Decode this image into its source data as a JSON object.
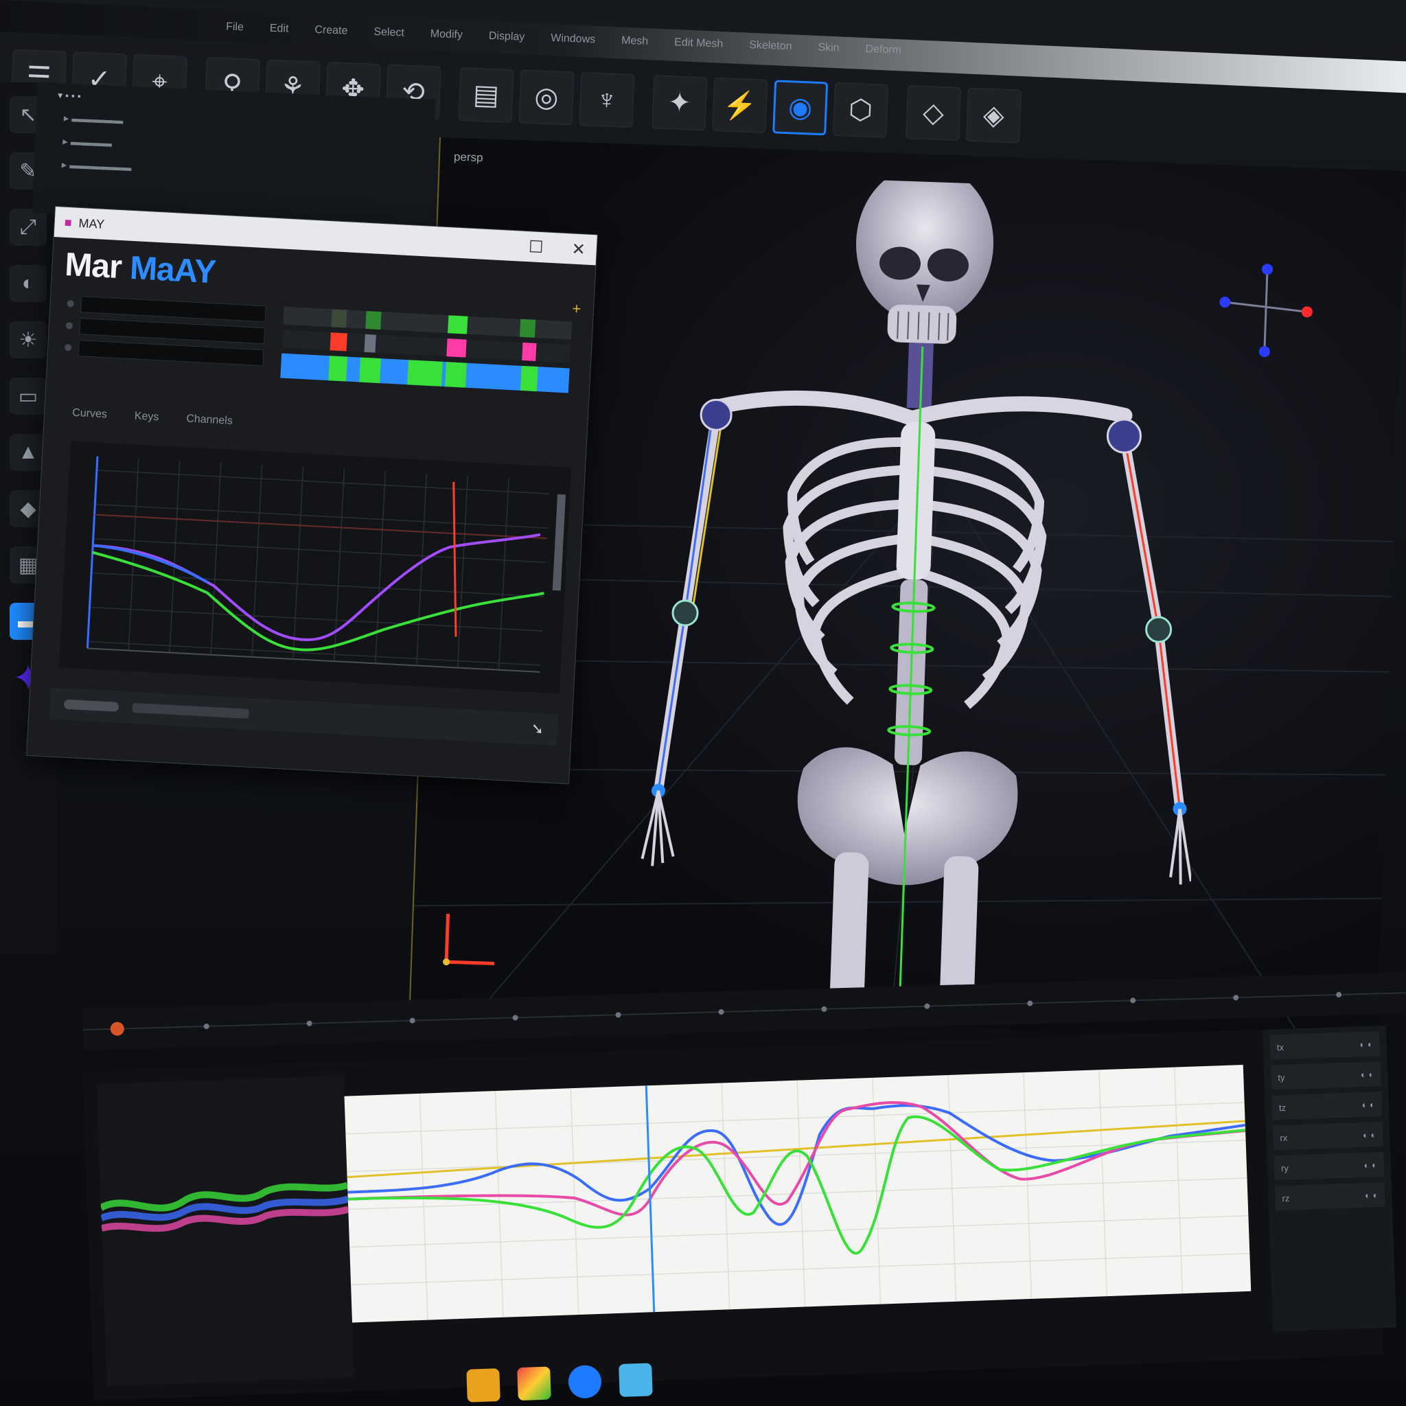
{
  "menubar": {
    "items": [
      "File",
      "Edit",
      "Create",
      "Select",
      "Modify",
      "Display",
      "Windows",
      "Mesh",
      "Edit Mesh",
      "Skeleton",
      "Skin",
      "Deform"
    ]
  },
  "shelf": {
    "tools": [
      {
        "name": "layout-icon",
        "glyph": "☰"
      },
      {
        "name": "check-icon",
        "glyph": "✓"
      },
      {
        "name": "lasso-icon",
        "glyph": "⌖"
      },
      {
        "name": "joint-tool-icon",
        "glyph": "⚲"
      },
      {
        "name": "ik-handle-icon",
        "glyph": "⚘"
      },
      {
        "name": "move-icon",
        "glyph": "✥"
      },
      {
        "name": "rotate-icon",
        "glyph": "⟲"
      },
      {
        "name": "graph-editor-icon",
        "glyph": "▤"
      },
      {
        "name": "orbit-icon",
        "glyph": "◎"
      },
      {
        "name": "pose-icon",
        "glyph": "♆"
      },
      {
        "name": "bone-icon",
        "glyph": "✦"
      },
      {
        "name": "render-icon",
        "glyph": "⚡"
      },
      {
        "name": "camera-icon",
        "glyph": "◉"
      },
      {
        "name": "snap-icon",
        "glyph": "⬡"
      },
      {
        "name": "key-tangent-icon",
        "glyph": "◇"
      },
      {
        "name": "key-diamond-icon",
        "glyph": "◈"
      }
    ],
    "active_index": 12
  },
  "viewport": {
    "tab_label": "persp",
    "camera_label": "persp"
  },
  "float_window": {
    "title": "MAY",
    "brand_word1": "Mar",
    "brand_word2": "MaAY",
    "tabs": [
      "Curves",
      "Keys",
      "Channels"
    ]
  },
  "graph_editor": {
    "channels": [
      "tx",
      "ty",
      "tz",
      "rx",
      "ry",
      "rz"
    ]
  },
  "colors": {
    "accent": "#2a8cff",
    "curve_blue": "#3b6cff",
    "curve_purple": "#a24cff",
    "curve_green": "#39e03a",
    "curve_pink": "#e84aa8",
    "curve_yellow": "#e2c02a",
    "playhead_red": "#ff3b2a"
  }
}
